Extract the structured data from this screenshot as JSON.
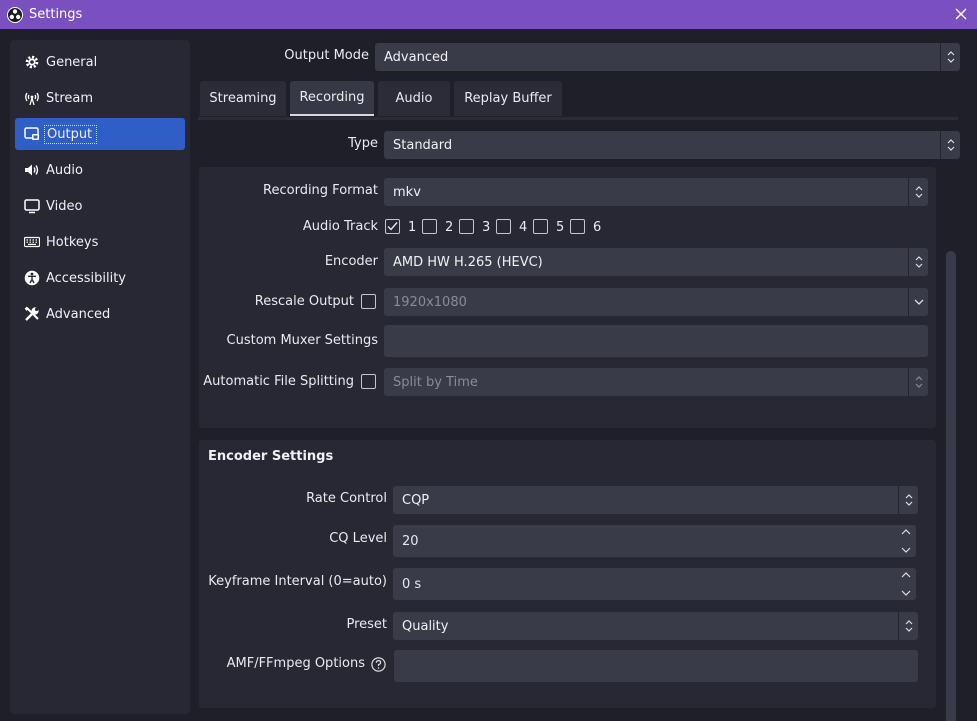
{
  "window": {
    "title": "Settings"
  },
  "sidebar": {
    "items": [
      {
        "label": "General",
        "icon": "gear-icon"
      },
      {
        "label": "Stream",
        "icon": "antenna-icon"
      },
      {
        "label": "Output",
        "icon": "output-icon",
        "active": true
      },
      {
        "label": "Audio",
        "icon": "speaker-icon"
      },
      {
        "label": "Video",
        "icon": "monitor-icon"
      },
      {
        "label": "Hotkeys",
        "icon": "keyboard-icon"
      },
      {
        "label": "Accessibility",
        "icon": "accessibility-icon"
      },
      {
        "label": "Advanced",
        "icon": "tools-icon"
      }
    ]
  },
  "output_mode": {
    "label": "Output Mode",
    "value": "Advanced"
  },
  "tabs": [
    {
      "label": "Streaming"
    },
    {
      "label": "Recording",
      "active": true
    },
    {
      "label": "Audio"
    },
    {
      "label": "Replay Buffer"
    }
  ],
  "recording": {
    "type": {
      "label": "Type",
      "value": "Standard"
    },
    "format": {
      "label": "Recording Format",
      "value": "mkv"
    },
    "audio_track": {
      "label": "Audio Track",
      "tracks": [
        "1",
        "2",
        "3",
        "4",
        "5",
        "6"
      ],
      "checked": [
        true,
        false,
        false,
        false,
        false,
        false
      ]
    },
    "encoder": {
      "label": "Encoder",
      "value": "AMD HW H.265 (HEVC)"
    },
    "rescale": {
      "label": "Rescale Output",
      "value": "1920x1080",
      "checked": false
    },
    "muxer": {
      "label": "Custom Muxer Settings",
      "value": ""
    },
    "splitting": {
      "label": "Automatic File Splitting",
      "value": "Split by Time",
      "checked": false
    }
  },
  "encoder_settings": {
    "title": "Encoder Settings",
    "rate_control": {
      "label": "Rate Control",
      "value": "CQP"
    },
    "cq_level": {
      "label": "CQ Level",
      "value": "20"
    },
    "keyframe": {
      "label": "Keyframe Interval (0=auto)",
      "value": "0 s"
    },
    "preset": {
      "label": "Preset",
      "value": "Quality"
    },
    "amf_options": {
      "label": "AMF/FFmpeg Options",
      "value": ""
    }
  },
  "colors": {
    "titlebar": "#7a4fbf",
    "accent": "#2f5ec6",
    "background": "#1e1f29",
    "panel": "#272833",
    "field": "#3a3b48"
  }
}
